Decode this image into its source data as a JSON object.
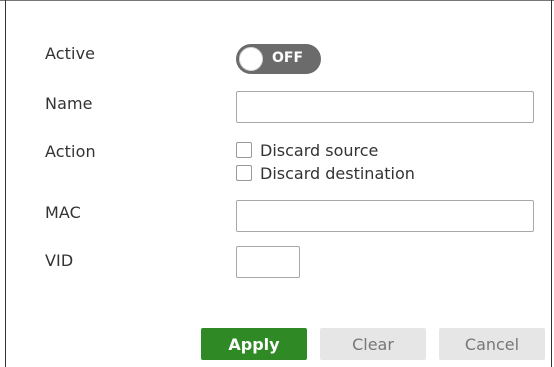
{
  "form": {
    "active": {
      "label": "Active",
      "toggle_state": "OFF"
    },
    "name": {
      "label": "Name",
      "value": ""
    },
    "action": {
      "label": "Action",
      "options": [
        {
          "label": "Discard source",
          "checked": false
        },
        {
          "label": "Discard destination",
          "checked": false
        }
      ]
    },
    "mac": {
      "label": "MAC",
      "value": ""
    },
    "vid": {
      "label": "VID",
      "value": ""
    }
  },
  "buttons": {
    "apply": "Apply",
    "clear": "Clear",
    "cancel": "Cancel"
  },
  "colors": {
    "apply_bg": "#2f8a26",
    "toggle_off_bg": "#6b6b6b",
    "secondary_bg": "#e6e6e6"
  }
}
